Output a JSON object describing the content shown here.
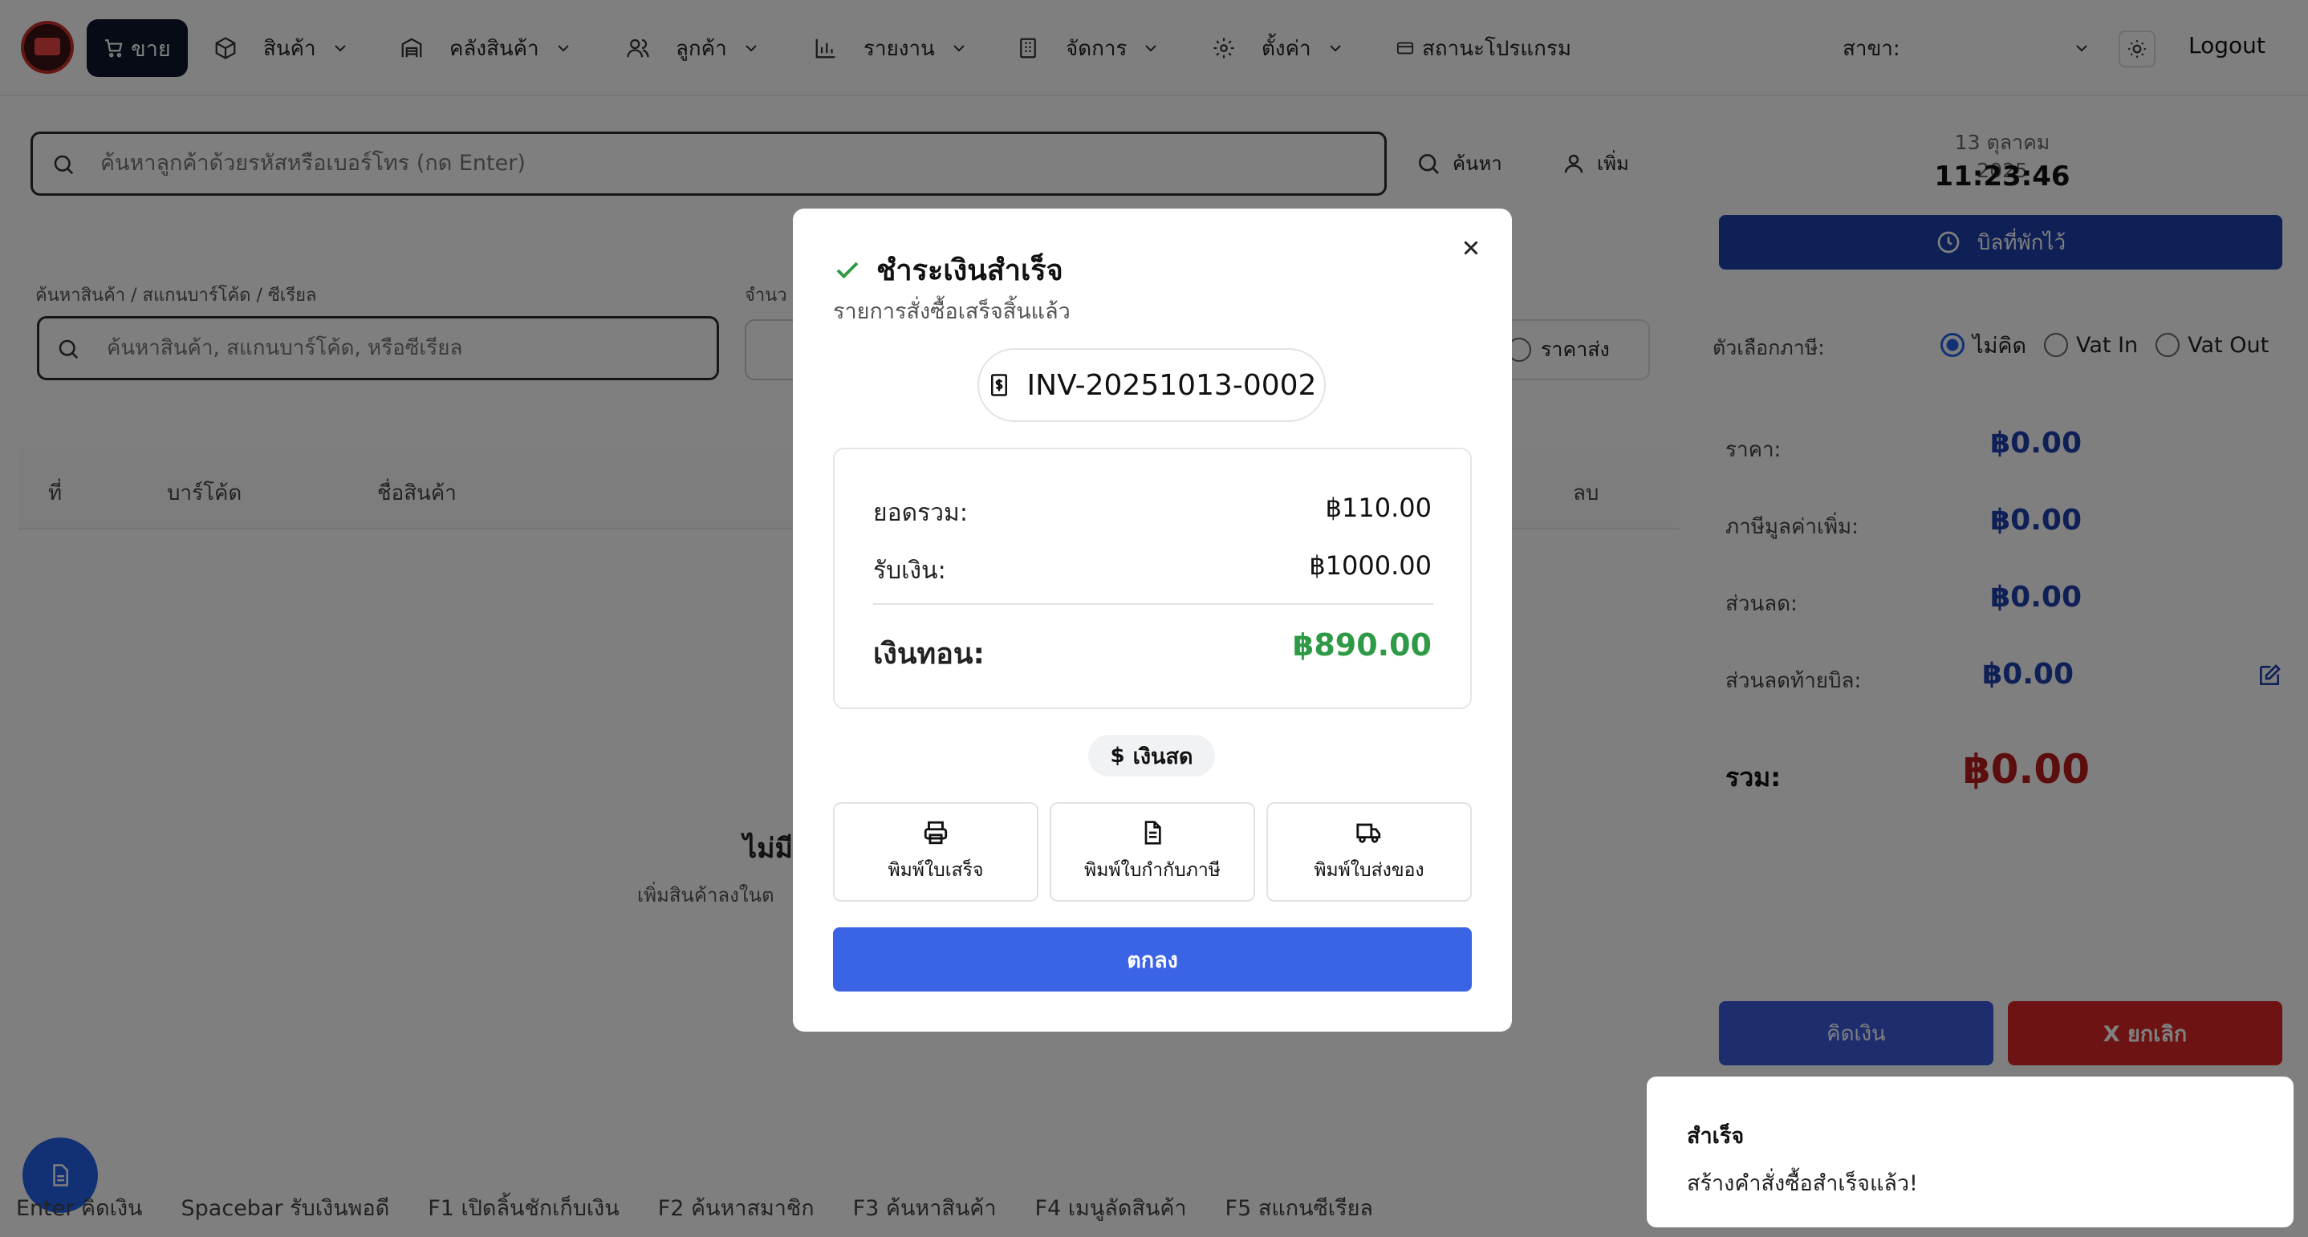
{
  "nav": {
    "sell": "ขาย",
    "items": [
      "สินค้า",
      "คลังสินค้า",
      "ลูกค้า",
      "รายงาน",
      "จัดการ",
      "ตั้งค่า"
    ],
    "program_status": "สถานะโปรแกรม",
    "branch_label": "สาขา:",
    "logout": "Logout"
  },
  "customer": {
    "placeholder": "ค้นหาลูกค้าด้วยรหัสหรือเบอร์โทร (กด Enter)",
    "search_btn": "ค้นหา",
    "add_btn": "เพิ่ม"
  },
  "product": {
    "label": "ค้นหาสินค้า / สแกนบาร์โค้ด / ซีเรียล",
    "placeholder": "ค้นหาสินค้า, สแกนบาร์โค้ด, หรือซีเรียล",
    "qty_label": "จำนว",
    "wholesale": "ราคาส่ง"
  },
  "table": {
    "columns": [
      "ที่",
      "บาร์โค้ด",
      "ชื่อสินค้า",
      "ลบ"
    ],
    "empty_title": "ไม่มี",
    "empty_sub": "เพิ่มสินค้าลงในต"
  },
  "shortcuts": [
    "Enter คิดเงิน",
    "Spacebar รับเงินพอดี",
    "F1 เปิดลิ้นชักเก็บเงิน",
    "F2 ค้นหาสมาชิก",
    "F3 ค้นหาสินค้า",
    "F4 เมนูลัดสินค้า",
    "F5 สแกนซีเรียล"
  ],
  "sidebar": {
    "date": "13 ตุลาคม 2025",
    "time": "11:23:46",
    "held_bills": "บิลที่พักไว้",
    "vat_label": "ตัวเลือกภาษี:",
    "vat_options": [
      "ไม่คิด",
      "Vat In",
      "Vat Out"
    ],
    "price_label": "ราคา:",
    "price": "฿0.00",
    "vat_amount_label": "ภาษีมูลค่าเพิ่ม:",
    "vat_amount": "฿0.00",
    "discount_label": "ส่วนลด:",
    "discount": "฿0.00",
    "bill_discount_label": "ส่วนลดท้ายบิล:",
    "bill_discount": "฿0.00",
    "total_label": "รวม:",
    "total": "฿0.00",
    "checkout": "คิดเงิน",
    "cancel": "X ยกเลิก"
  },
  "modal": {
    "title": "ชำระเงินสำเร็จ",
    "subtitle": "รายการสั่งซื้อเสร็จสิ้นแล้ว",
    "invoice": "INV-20251013-0002",
    "total_label": "ยอดรวม:",
    "total": "฿110.00",
    "received_label": "รับเงิน:",
    "received": "฿1000.00",
    "change_label": "เงินทอน:",
    "change": "฿890.00",
    "payment_method": "เงินสด",
    "print_receipt": "พิมพ์ใบเสร็จ",
    "print_tax_invoice": "พิมพ์ใบกำกับภาษี",
    "print_delivery": "พิมพ์ใบส่งของ",
    "ok": "ตกลง"
  },
  "toast": {
    "title": "สำเร็จ",
    "message": "สร้างคำสั่งซื้อสำเร็จแล้ว!"
  },
  "colors": {
    "primary": "#3a63e5",
    "success": "#2e9a45",
    "danger": "#b91c1c",
    "navy": "#1e40af"
  },
  "icons": [
    "cart-icon",
    "box-icon",
    "warehouse-icon",
    "users-icon",
    "chart-icon",
    "building-icon",
    "gear-icon",
    "card-icon",
    "sun-icon",
    "search-icon",
    "user-icon",
    "clock-icon",
    "edit-icon",
    "check-icon",
    "close-icon",
    "receipt-icon",
    "dollar-icon",
    "printer-icon",
    "document-icon",
    "truck-icon"
  ]
}
